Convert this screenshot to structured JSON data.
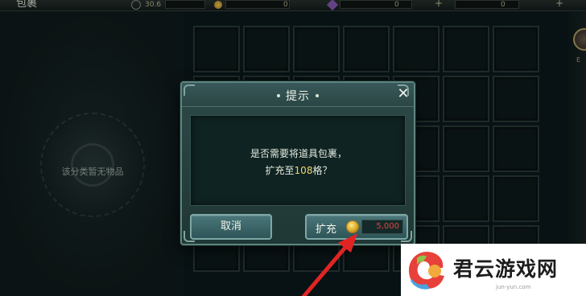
{
  "top_bar": {
    "title": "包裹",
    "resource_1": "30.6",
    "resource_2": "0",
    "resource_3": "0",
    "resource_4": "0"
  },
  "inventory": {
    "empty_message": "该分类暂无物品",
    "avatar_label": "E"
  },
  "dialog": {
    "title": "提示",
    "message_line1": "是否需要将道具包裹，",
    "message_line2_prefix": "扩充至",
    "message_line2_highlight": "108",
    "message_line2_suffix": "格？",
    "cancel_label": "取消",
    "expand_label": "扩充",
    "expand_cost": "5,000"
  },
  "watermark": {
    "text": "君云游戏网",
    "subtext": "jun-yun.com"
  },
  "colors": {
    "dialog_bg": "#2d4947",
    "highlight": "#f1d56a",
    "cost_red": "#e0453f",
    "arrow_red": "#e02424"
  },
  "icons": [
    "close-icon",
    "gold-coin-icon",
    "search-icon",
    "red-arrow-annotation",
    "watermark-logo"
  ]
}
